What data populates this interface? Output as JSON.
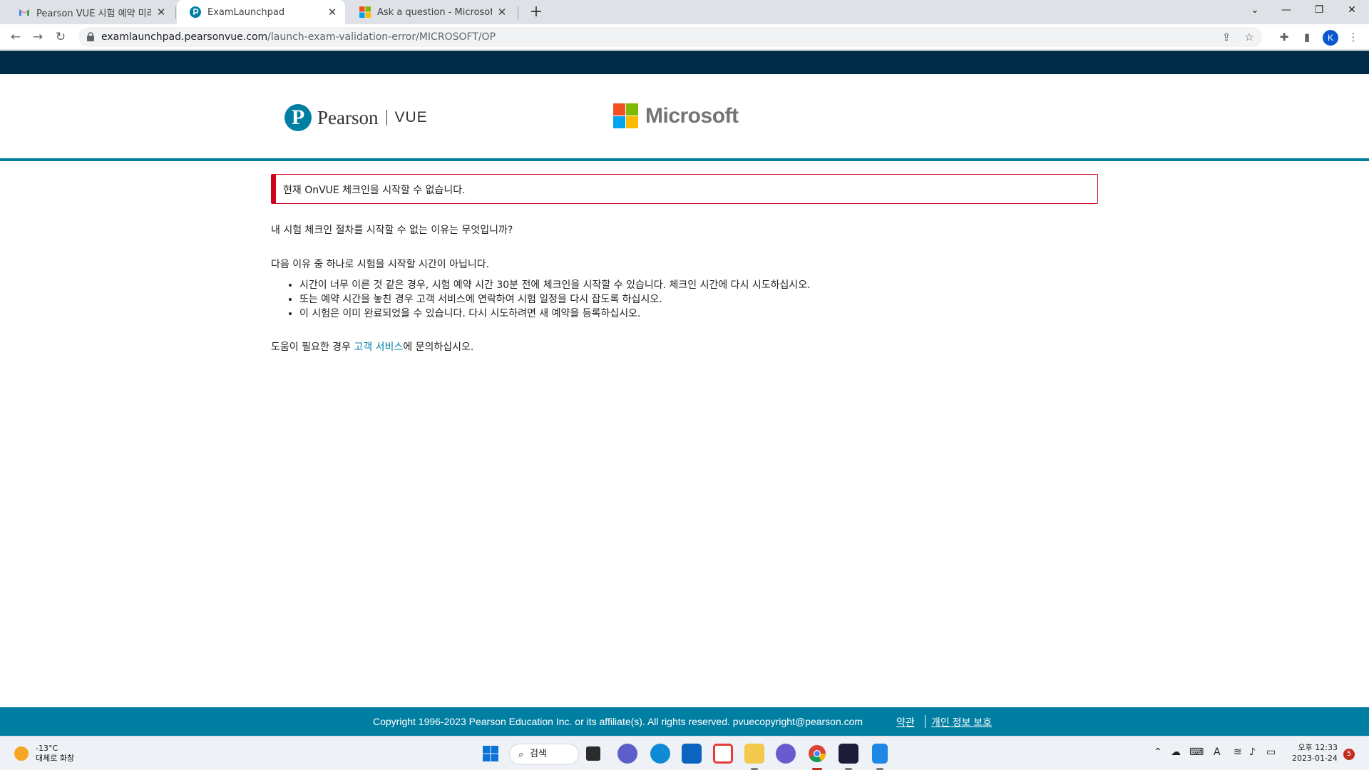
{
  "browser": {
    "tabs": [
      {
        "title": "Pearson VUE 시험 예약 미리 알림",
        "icon": "gmail-icon"
      },
      {
        "title": "ExamLaunchpad",
        "icon": "pearson-icon"
      },
      {
        "title": "Ask a question - Microsoft Q&A",
        "icon": "microsoft-icon"
      }
    ],
    "new_tab": "+",
    "url_host": "examlaunchpad.pearsonvue.com",
    "url_path": "/launch-exam-validation-error/MICROSOFT/OP",
    "profile_initial": "K"
  },
  "header": {
    "pearson_logo_letter": "P",
    "pearson_name": "Pearson",
    "pearson_vue": "VUE",
    "microsoft_name": "Microsoft"
  },
  "main": {
    "alert": "현재 OnVUE 체크인을 시작할 수 없습니다.",
    "question": "내 시험 체크인 절차를 시작할 수 없는 이유는 무엇입니까?",
    "intro": "다음 이유 중 하나로 시험을 시작할 시간이 아닙니다.",
    "reasons": [
      "시간이 너무 이른 것 같은 경우, 시험 예약 시간 30분 전에 체크인을 시작할 수 있습니다. 체크인 시간에 다시 시도하십시오.",
      "또는 예약 시간을 놓친 경우 고객 서비스에 연락하여 시험 일정을 다시 잡도록 하십시오.",
      "이 시험은 이미 완료되었을 수 있습니다. 다시 시도하려면 새 예약을 등록하십시오."
    ],
    "help_prefix": "도움이 필요한 경우 ",
    "help_link": "고객 서비스",
    "help_suffix": "에 문의하십시오."
  },
  "footer": {
    "copyright": "Copyright 1996-2023 Pearson Education Inc. or its affiliate(s). All rights reserved. pvuecopyright@pearson.com",
    "terms": "약관",
    "privacy": "개인 정보 보호"
  },
  "taskbar": {
    "weather_temp": "-13°C",
    "weather_desc": "대체로 화창",
    "search_label": "검색",
    "clock_time": "오후 12:33",
    "clock_date": "2023-01-24",
    "notification_count": "5"
  },
  "colors": {
    "brand_dark": "#002b49",
    "brand_teal": "#007fa3",
    "alert_red": "#d0021b"
  }
}
